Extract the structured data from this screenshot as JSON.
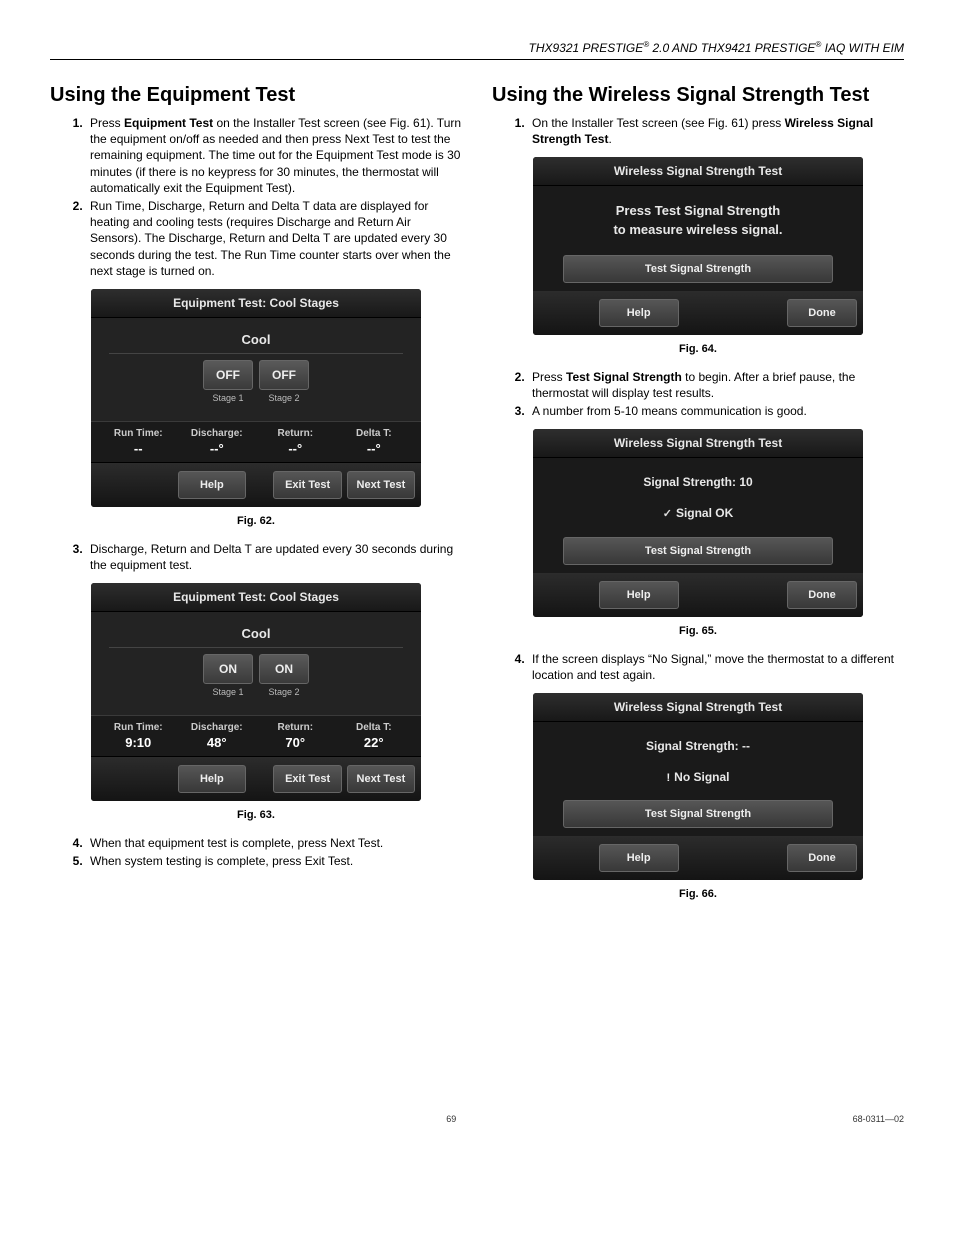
{
  "header": "THX9321 PRESTIGE® 2.0 AND THX9421 PRESTIGE® IAQ WITH EIM",
  "left": {
    "heading": "Using the Equipment Test",
    "items": [
      "Press <b>Equipment Test</b> on the Installer Test screen (see Fig. 61). Turn the equipment on/off as needed and then press Next Test to test the remaining equipment. The time out for the Equipment Test mode is 30 minutes (if there is no keypress for 30 minutes, the thermostat will automatically exit the Equipment Test).",
      "Run Time, Discharge, Return and Delta T data are displayed for heating and cooling tests (requires Discharge and Return Air Sensors). The Discharge, Return and Delta T are updated every 30 seconds during the test. The Run Time counter starts over when the next stage is turned on."
    ],
    "fig62": {
      "title": "Equipment Test:  Cool Stages",
      "sub": "Cool",
      "stage1_btn": "OFF",
      "stage1_lbl": "Stage 1",
      "stage2_btn": "OFF",
      "stage2_lbl": "Stage 2",
      "run_lbl": "Run Time:",
      "run_val": "--",
      "dis_lbl": "Discharge:",
      "dis_val": "--°",
      "ret_lbl": "Return:",
      "ret_val": "--°",
      "del_lbl": "Delta T:",
      "del_val": "--°",
      "help": "Help",
      "exit": "Exit Test",
      "next": "Next Test",
      "caption": "Fig. 62."
    },
    "item3": "Discharge, Return and Delta T are updated every 30 seconds during the equipment test.",
    "fig63": {
      "title": "Equipment Test:  Cool Stages",
      "sub": "Cool",
      "stage1_btn": "ON",
      "stage1_lbl": "Stage 1",
      "stage2_btn": "ON",
      "stage2_lbl": "Stage 2",
      "run_lbl": "Run Time:",
      "run_val": "9:10",
      "dis_lbl": "Discharge:",
      "dis_val": "48°",
      "ret_lbl": "Return:",
      "ret_val": "70°",
      "del_lbl": "Delta T:",
      "del_val": "22°",
      "help": "Help",
      "exit": "Exit Test",
      "next": "Next Test",
      "caption": "Fig. 63."
    },
    "item4": "When that equipment test is complete, press Next Test.",
    "item5": "When system testing is complete, press Exit Test."
  },
  "right": {
    "heading": "Using the Wireless Signal Strength Test",
    "item1": "On the Installer Test screen (see Fig. 61) press <b>Wireless Signal Strength Test</b>.",
    "fig64": {
      "title": "Wireless Signal Strength Test",
      "msg1": "Press Test Signal Strength",
      "msg2": "to measure wireless signal.",
      "test": "Test Signal Strength",
      "help": "Help",
      "done": "Done",
      "caption": "Fig. 64."
    },
    "item2": "Press <b>Test Signal Strength</b> to begin. After a brief pause, the thermostat will display test results.",
    "item3": "A number from 5-10 means communication is good.",
    "fig65": {
      "title": "Wireless Signal Strength Test",
      "strength_lbl": "Signal Strength:  10",
      "status": "Signal OK",
      "test": "Test Signal Strength",
      "help": "Help",
      "done": "Done",
      "caption": "Fig. 65."
    },
    "item4": "If the screen displays “No Signal,” move the thermostat to a different location and test again.",
    "fig66": {
      "title": "Wireless Signal Strength Test",
      "strength_lbl": "Signal Strength:  --",
      "status": "No Signal",
      "test": "Test Signal Strength",
      "help": "Help",
      "done": "Done",
      "caption": "Fig. 66."
    }
  },
  "footer": {
    "page": "69",
    "doc": "68-0311—02"
  }
}
